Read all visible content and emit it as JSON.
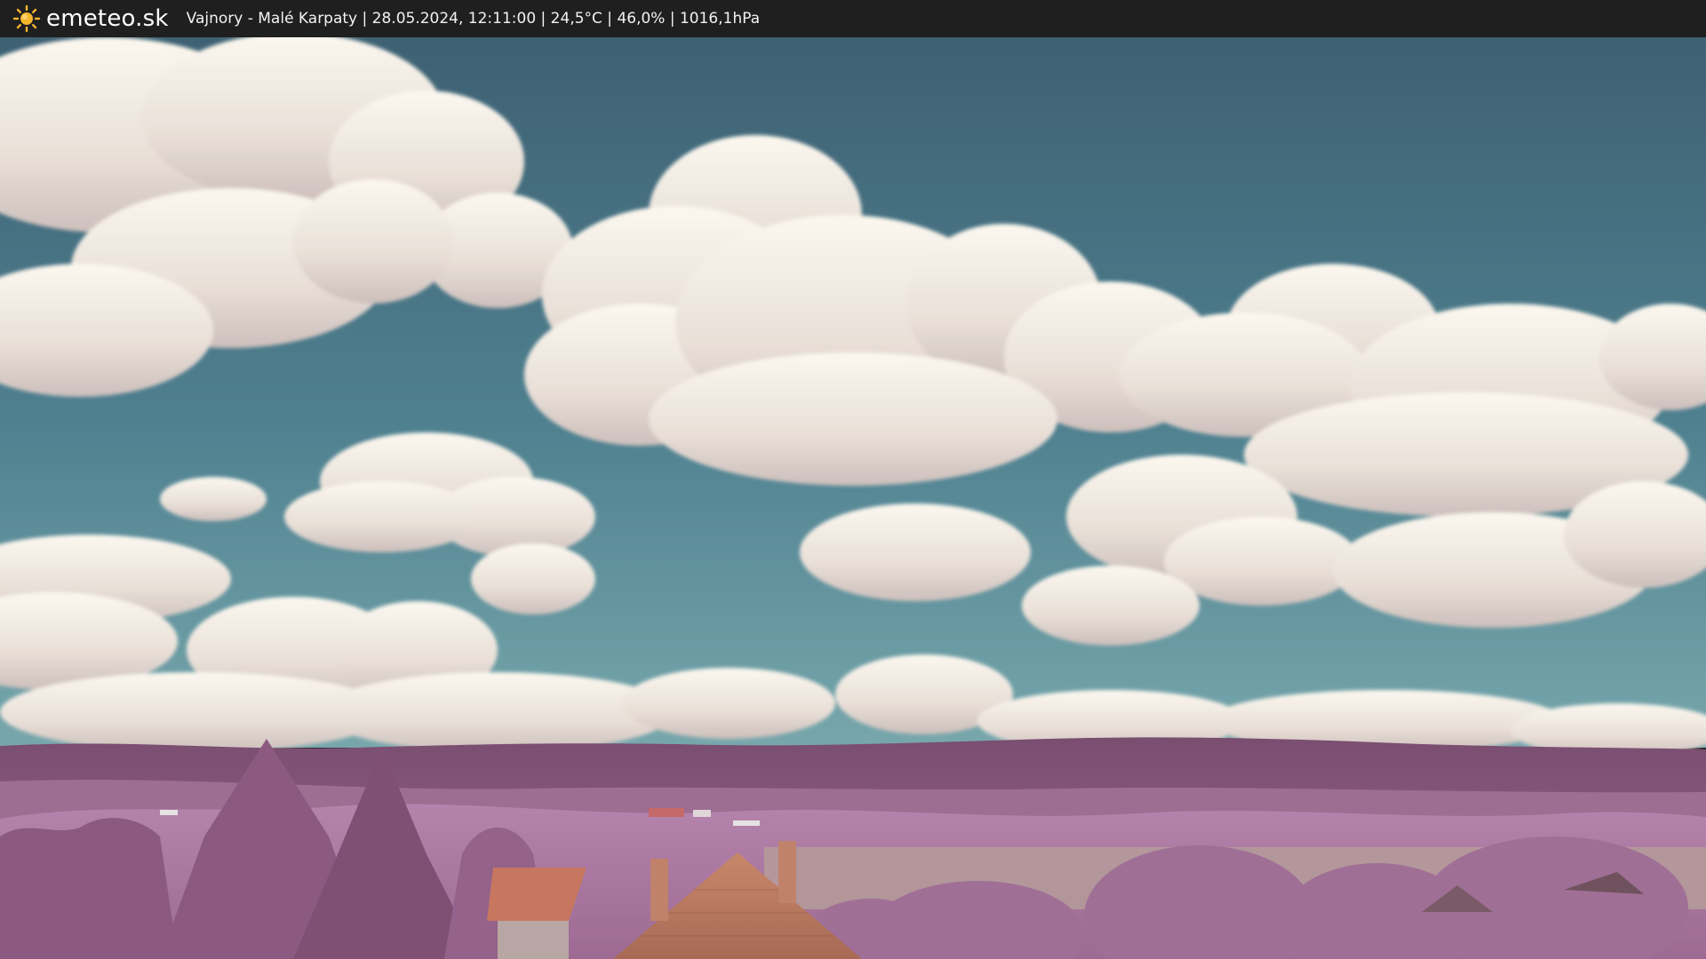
{
  "header": {
    "brand_name": "emeteo.sk",
    "logo_icon": "sun-icon",
    "status_text": "Vajnory - Malé Karpaty | 28.05.2024, 12:11:00 | 24,5°C | 46,0% | 1016,1hPa"
  },
  "colors": {
    "header_bg": "#1f1f1f",
    "sun_yellow": "#f5b52e",
    "sky_top": "#3f6475",
    "sky_bottom": "#5e95a0",
    "cloud": "#efe8e0",
    "foliage": "#a86b98",
    "roof": "#c4775f"
  }
}
